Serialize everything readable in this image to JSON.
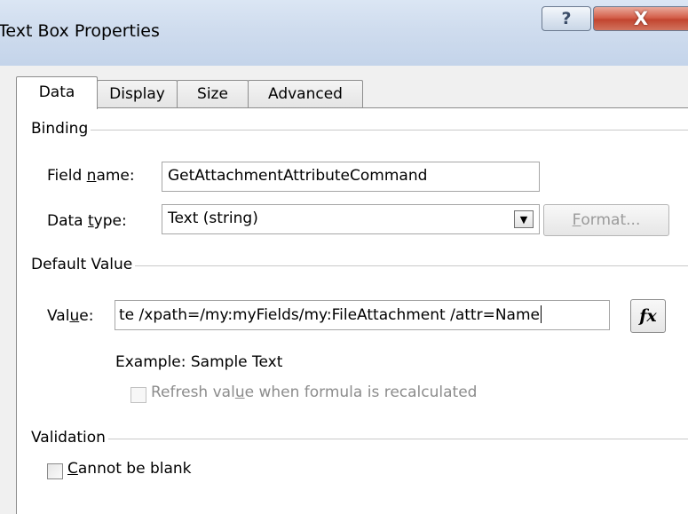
{
  "window": {
    "title": "Text Box Properties",
    "help_glyph": "?",
    "close_glyph": "X"
  },
  "tabs": [
    {
      "label": "Data",
      "active": true
    },
    {
      "label": "Display",
      "active": false
    },
    {
      "label": "Size",
      "active": false
    },
    {
      "label": "Advanced",
      "active": false
    }
  ],
  "binding": {
    "section_label": "Binding",
    "field_name_label_pre": "Field ",
    "field_name_label_u": "n",
    "field_name_label_post": "ame:",
    "field_name_value": "GetAttachmentAttributeCommand",
    "data_type_label_pre": "Data ",
    "data_type_label_u": "t",
    "data_type_label_post": "ype:",
    "data_type_value": "Text (string)",
    "format_label_u": "F",
    "format_label_post": "ormat..."
  },
  "default_value": {
    "section_label": "Default Value",
    "value_label_pre": "Val",
    "value_label_u": "u",
    "value_label_post": "e:",
    "value_text": "te /xpath=/my:myFields/my:FileAttachment /attr=Name",
    "fx_label": "fx",
    "example_text": "Example: Sample Text",
    "refresh_label_pre": "Refresh val",
    "refresh_label_u": "u",
    "refresh_label_post": "e when formula is recalculated"
  },
  "validation": {
    "section_label": "Validation",
    "cannot_blank_u": "C",
    "cannot_blank_post": "annot be blank"
  },
  "colors": {
    "titlebar": "#cfdcee",
    "close_button": "#c24530",
    "panel_background": "#ffffff",
    "disabled_text": "#9a9a9a"
  }
}
